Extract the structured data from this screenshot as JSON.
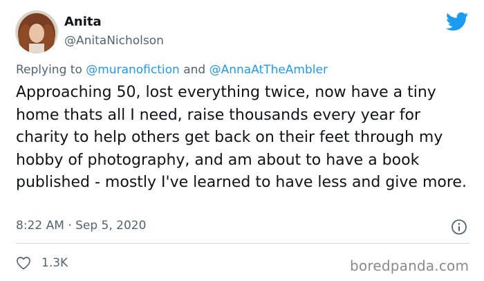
{
  "author": {
    "name": "Anita",
    "handle": "@AnitaNicholson"
  },
  "reply": {
    "prefix": "Replying to ",
    "mention1": "@muranofiction",
    "joiner": " and ",
    "mention2": "@AnnaAtTheAmbler"
  },
  "tweet": {
    "text": "Approaching 50, lost everything twice, now have a tiny home thats all I need, raise thousands every year for charity to help others get back on their feet through my hobby of photography, and am about to have a book published - mostly I've learned to have less and give more.",
    "timestamp": "8:22 AM · Sep 5, 2020",
    "likes": "1.3K"
  },
  "watermark": "boredpanda.com",
  "icons": {
    "brand": "twitter-bird-icon",
    "info": "info-icon",
    "like": "heart-icon"
  },
  "colors": {
    "accent": "#1d9bf0",
    "text": "#0f1419",
    "secondary": "#536471"
  }
}
